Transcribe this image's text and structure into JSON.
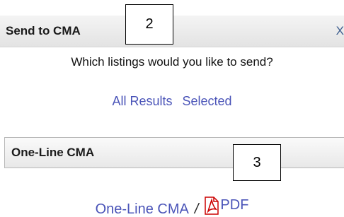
{
  "dialog": {
    "title": "Send to CMA",
    "close_label": "X"
  },
  "callouts": {
    "top": "2",
    "bottom": "3"
  },
  "question": "Which listings would you like to send?",
  "results_links": {
    "all_results": "All Results",
    "selected": "Selected"
  },
  "section": {
    "title": "One-Line CMA"
  },
  "output_links": {
    "one_line_cma": "One-Line CMA",
    "separator": "/",
    "pdf": "PDF"
  },
  "icons": {
    "pdf": "pdf-file-icon"
  },
  "colors": {
    "link": "#4a54b8",
    "pdf_icon": "#cc0000"
  }
}
